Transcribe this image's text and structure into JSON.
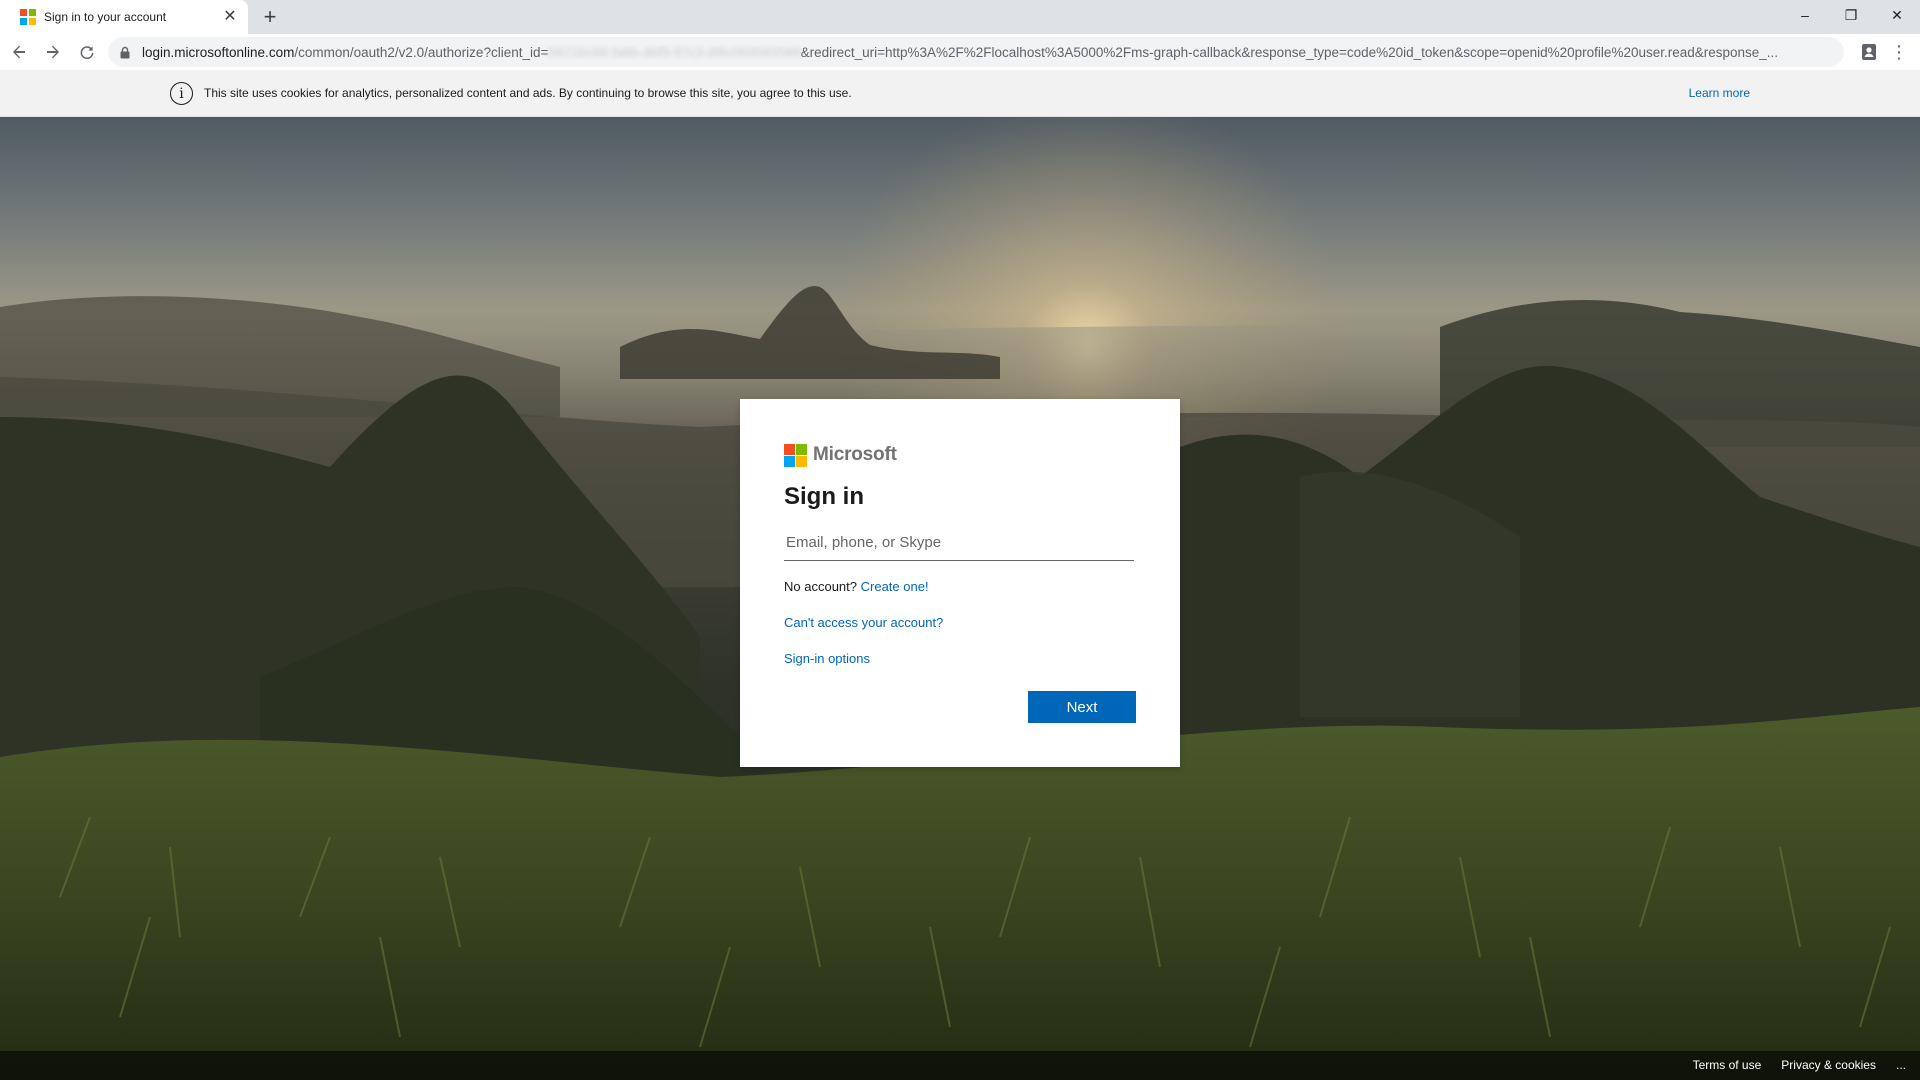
{
  "browser": {
    "tab_title": "Sign in to your account",
    "tab_close": "✕",
    "new_tab": "+",
    "url_host": "login.microsoftonline.com",
    "url_path_1": "/common/oauth2/v2.0/authorize?client_id=",
    "url_redacted": "5821bc68-fa8b-4bf9-97c3-4f6c0b9583588",
    "url_path_2": "&redirect_uri=http%3A%2F%2Flocalhost%3A5000%2Fms-graph-callback&response_type=code%20id_token&scope=openid%20profile%20user.read&response_...",
    "minimize": "–",
    "restore": "❐",
    "close": "✕",
    "menu": "⋮"
  },
  "cookie_banner": {
    "icon": "i",
    "text": "This site uses cookies for analytics, personalized content and ads. By continuing to browse this site, you agree to this use.",
    "learn_more": "Learn more"
  },
  "signin": {
    "brand": "Microsoft",
    "heading": "Sign in",
    "email_placeholder": "Email, phone, or Skype",
    "email_value": "",
    "no_account_text": "No account?",
    "create_link": "Create one!",
    "cant_access_link": "Can't access your account?",
    "signin_options_link": "Sign-in options",
    "next_button": "Next"
  },
  "footer": {
    "terms": "Terms of use",
    "privacy": "Privacy & cookies",
    "more": "..."
  },
  "colors": {
    "accent": "#0067b8",
    "logo_red": "#f25022",
    "logo_green": "#7fba00",
    "logo_blue": "#00a4ef",
    "logo_yellow": "#ffb900"
  }
}
